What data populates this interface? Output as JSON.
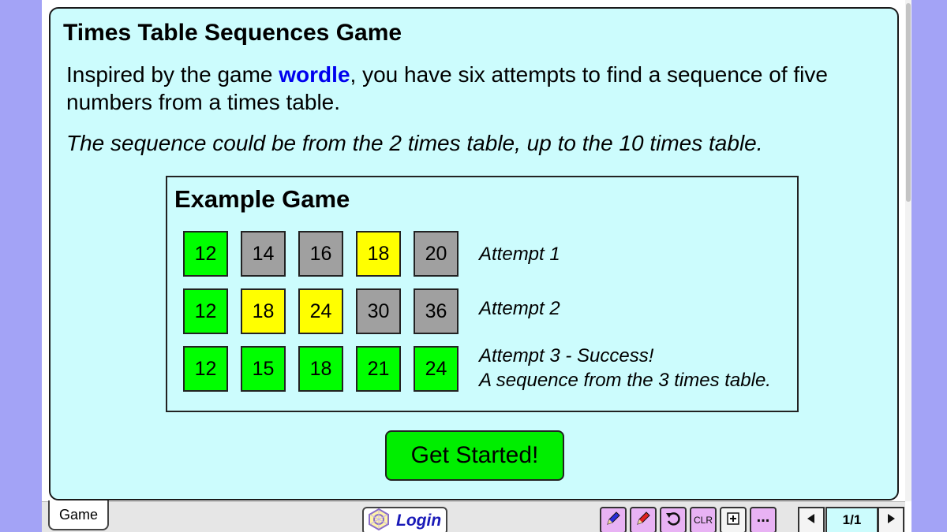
{
  "title": "Times Table Sequences Game",
  "intro": {
    "before": "Inspired by the game ",
    "link": "wordle",
    "after": ", you have six attempts to find a sequence of five numbers from a times table."
  },
  "note": "The sequence could be from the 2 times table, up to the 10 times table.",
  "example": {
    "title": "Example Game",
    "attempts": [
      {
        "cells": [
          {
            "value": "12",
            "color": "green"
          },
          {
            "value": "14",
            "color": "grey"
          },
          {
            "value": "16",
            "color": "grey"
          },
          {
            "value": "18",
            "color": "yellow"
          },
          {
            "value": "20",
            "color": "grey"
          }
        ],
        "label": "Attempt 1"
      },
      {
        "cells": [
          {
            "value": "12",
            "color": "green"
          },
          {
            "value": "18",
            "color": "yellow"
          },
          {
            "value": "24",
            "color": "yellow"
          },
          {
            "value": "30",
            "color": "grey"
          },
          {
            "value": "36",
            "color": "grey"
          }
        ],
        "label": "Attempt 2"
      },
      {
        "cells": [
          {
            "value": "12",
            "color": "green"
          },
          {
            "value": "15",
            "color": "green"
          },
          {
            "value": "18",
            "color": "green"
          },
          {
            "value": "21",
            "color": "green"
          },
          {
            "value": "24",
            "color": "green"
          }
        ],
        "label": "Attempt 3 - Success!",
        "label2": "A sequence from the 3 times table."
      }
    ]
  },
  "button": "Get Started!",
  "bottom": {
    "tab": "Game",
    "login": "Login",
    "tools": {
      "clr": "CLR",
      "more": "..."
    },
    "page": "1/1"
  },
  "colors": {
    "green": "#00ff00",
    "grey": "#a0a0a0",
    "yellow": "#ffff00",
    "panel": "#ccfcfd",
    "background": "#a3a3f6"
  },
  "icons": [
    "pen-blue-icon",
    "pen-red-icon",
    "undo-icon",
    "plus-icon",
    "prev-page-icon",
    "next-page-icon",
    "login-logo-icon"
  ]
}
